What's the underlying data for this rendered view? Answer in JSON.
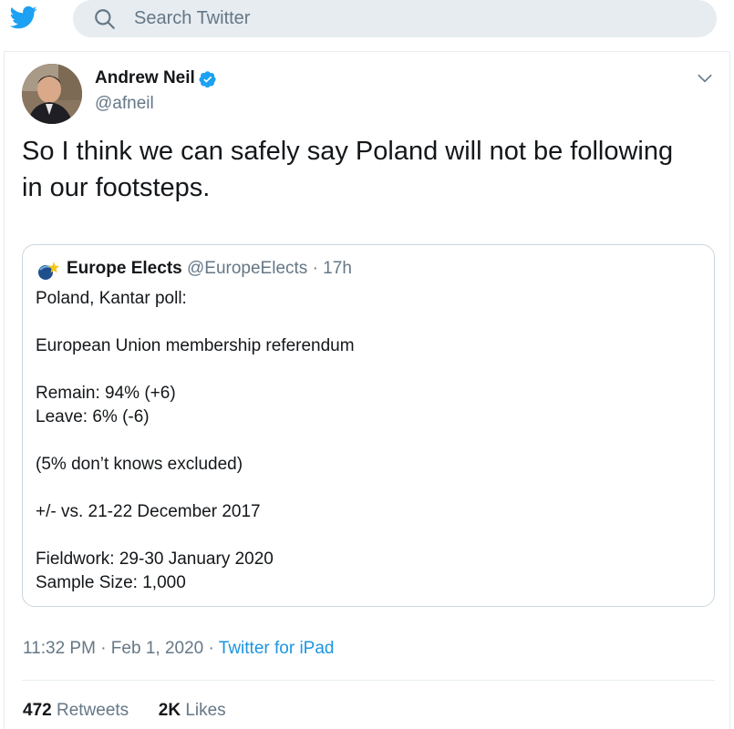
{
  "header": {
    "search_placeholder": "Search Twitter"
  },
  "tweet": {
    "author_name": "Andrew Neil",
    "author_handle": "@afneil",
    "text_line1": "So I think we can safely say Poland will not be following",
    "text_line2": "in our footsteps.",
    "timestamp": "11:32 PM · Feb 1, 2020 ·",
    "source": "Twitter for iPad",
    "retweets_count": "472",
    "retweets_label": "Retweets",
    "likes_count": "2K",
    "likes_label": "Likes"
  },
  "quoted_tweet": {
    "author_name": "Europe Elects",
    "meta": "@EuropeElects · 17h",
    "lines": [
      "Poland, Kantar poll:",
      "",
      "European Union membership referendum",
      "",
      "Remain: 94% (+6)",
      "Leave: 6% (-6)",
      "",
      "(5% don’t knows excluded)",
      "",
      "+/- vs. 21-22 December 2017",
      "",
      "Fieldwork: 29-30 January 2020",
      "Sample Size: 1,000"
    ]
  },
  "colors": {
    "accent": "#1da1f2",
    "link": "#1b95e0",
    "muted": "#657786",
    "text": "#14171a",
    "search_bg": "#e6ecf0",
    "border": "#ccd6dd"
  },
  "icons": [
    "twitter-bird-icon",
    "search-icon",
    "verified-badge-icon",
    "chevron-down-icon"
  ]
}
